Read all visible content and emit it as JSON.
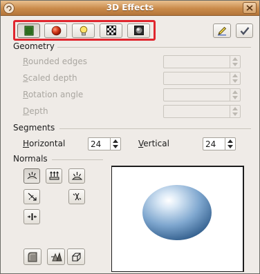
{
  "window": {
    "title": "3D Effects"
  },
  "toolbar": {
    "buttons": [
      {
        "name": "geometry",
        "icon": "geometry-cube-icon"
      },
      {
        "name": "shading",
        "icon": "shading-sphere-icon"
      },
      {
        "name": "illumination",
        "icon": "lightbulb-icon"
      },
      {
        "name": "textures",
        "icon": "checkerboard-texture-icon"
      },
      {
        "name": "material",
        "icon": "material-icon"
      }
    ],
    "right_buttons": [
      {
        "name": "update",
        "icon": "pencil-icon"
      },
      {
        "name": "assign",
        "icon": "checkmark-icon"
      }
    ]
  },
  "geometry": {
    "heading": "Geometry",
    "fields": [
      {
        "label_first": "R",
        "label_rest": "ounded edges",
        "value": ""
      },
      {
        "label_first": "S",
        "label_rest": "caled depth",
        "value": ""
      },
      {
        "label_first": "R",
        "label_rest": "otation angle",
        "value": ""
      },
      {
        "label_first": "D",
        "label_rest": "epth",
        "value": ""
      }
    ]
  },
  "segments": {
    "heading": "Segments",
    "horizontal": {
      "label_first": "H",
      "label_rest": "orizontal",
      "value": "24"
    },
    "vertical": {
      "label_first": "V",
      "label_rest": "ertical",
      "value": "24"
    }
  },
  "normals": {
    "heading": "Normals"
  },
  "colors": {
    "highlight": "#e0262e",
    "sphere_light": "#dbe9f6",
    "sphere_dark": "#4f7fae"
  }
}
